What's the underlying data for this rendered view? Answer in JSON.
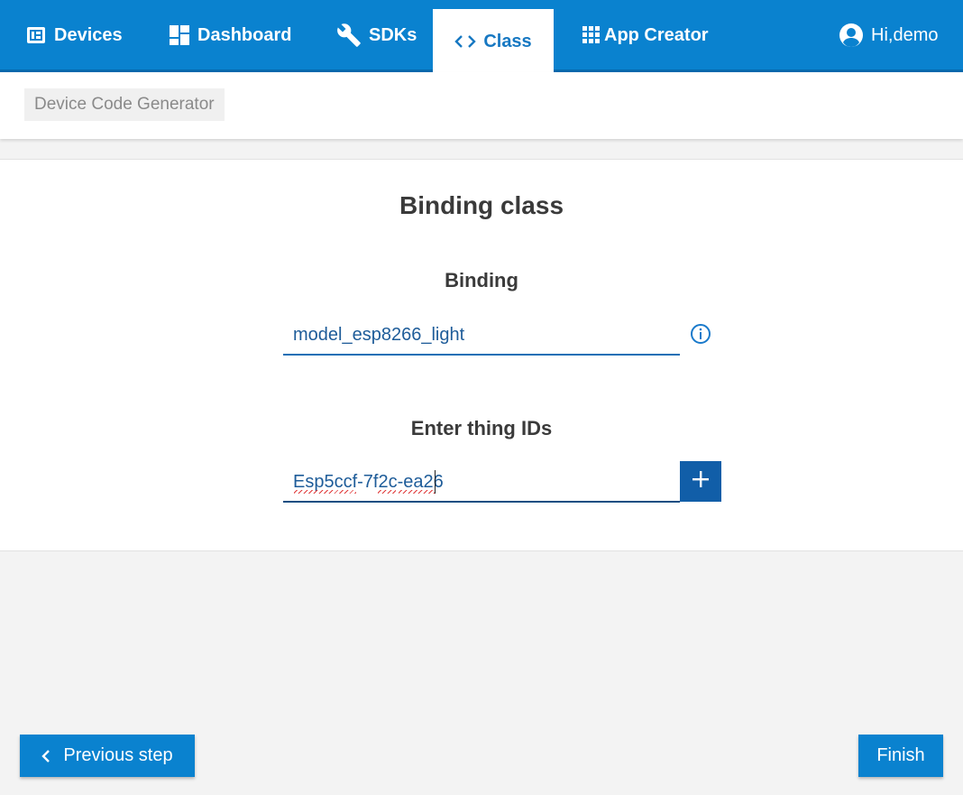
{
  "nav": {
    "devices": "Devices",
    "dashboard": "Dashboard",
    "sdks": "SDKs",
    "class": "Class",
    "app_creator": "App Creator",
    "user": "Hi,demo"
  },
  "breadcrumb": "Device Code Generator",
  "main": {
    "title": "Binding class",
    "binding_label": "Binding",
    "binding_value": "model_esp8266_light",
    "thing_label": "Enter thing IDs",
    "thing_value": "Esp5ccf-7f2c-ea26"
  },
  "footer": {
    "prev_label": "Previous step",
    "finish_label": "Finish"
  },
  "colors": {
    "nav_bg": "#0a82cf",
    "accent": "#1778c2",
    "add_button": "#115ea8"
  },
  "icons": [
    "devices-icon",
    "dashboard-icon",
    "wrench-icon",
    "code-icon",
    "apps-grid-icon",
    "user-avatar-icon",
    "info-icon",
    "plus-icon",
    "chevron-left-icon"
  ]
}
